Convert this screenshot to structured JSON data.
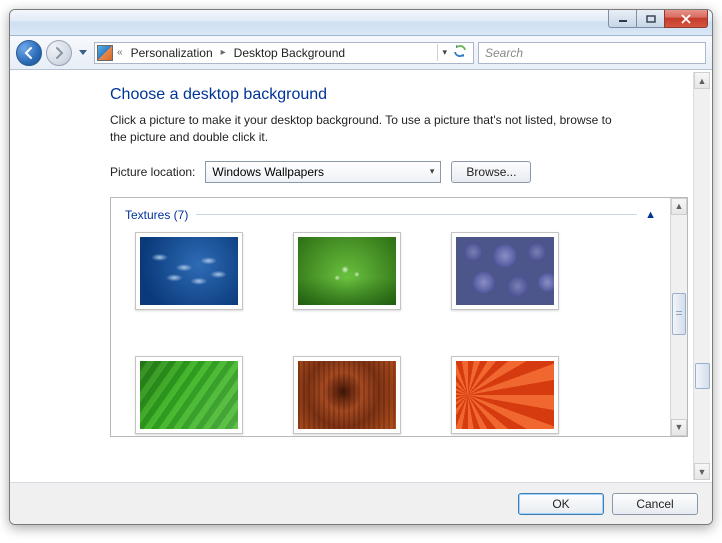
{
  "titlebar": {},
  "nav": {
    "crumb1": "Personalization",
    "crumb2": "Desktop Background",
    "search_placeholder": "Search"
  },
  "main": {
    "heading": "Choose a desktop background",
    "subtext": "Click a picture to make it your desktop background. To use a picture that's not listed, browse to the picture and double click it.",
    "location_label": "Picture location:",
    "location_value": "Windows Wallpapers",
    "browse_label": "Browse...",
    "group_label": "Textures (7)"
  },
  "footer": {
    "ok": "OK",
    "cancel": "Cancel"
  }
}
